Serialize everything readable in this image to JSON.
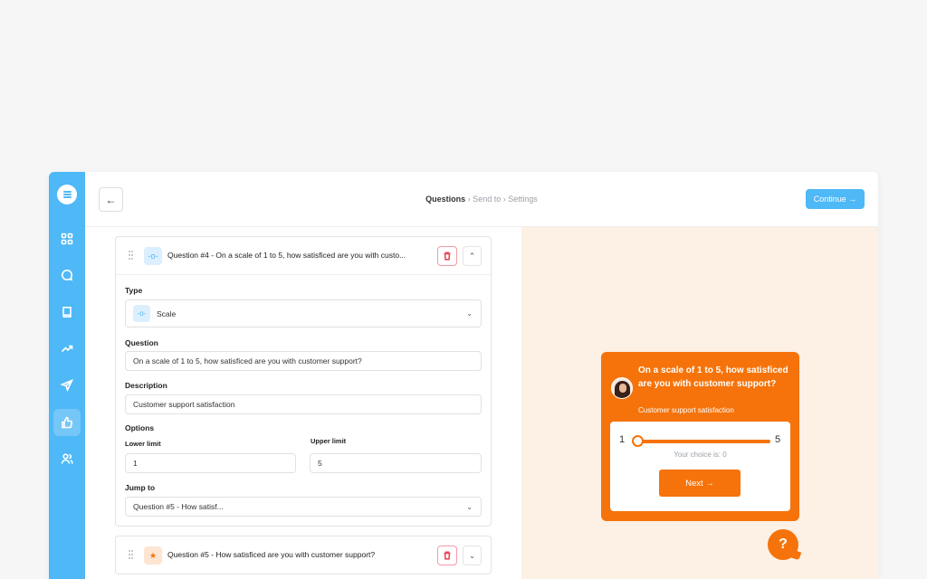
{
  "header": {
    "back_icon": "arrow-left-icon",
    "breadcrumb": [
      {
        "label": "Questions",
        "sep": "›"
      },
      {
        "label": "Send to",
        "sep": "›"
      },
      {
        "label": "Settings",
        "sep": ""
      }
    ],
    "continue_label": "Continue",
    "continue_arrow": "→"
  },
  "sidebar": {
    "items": [
      {
        "icon": "grid-icon"
      },
      {
        "icon": "chat-bubble-icon"
      },
      {
        "icon": "book-icon"
      },
      {
        "icon": "trending-up-icon"
      },
      {
        "icon": "send-icon"
      },
      {
        "icon": "thumbs-up-icon",
        "active": true
      },
      {
        "icon": "users-icon"
      }
    ]
  },
  "question4": {
    "icon_glyph": "-o-",
    "title": "Question #4 - On a scale of 1 to 5, how satisficed are you with custo...",
    "chevron": "⌃",
    "type_label": "Type",
    "type_value": "Scale",
    "type_icon_glyph": "-o-",
    "question_label": "Question",
    "question_value": "On a scale of 1 to 5, how satisficed are you with customer support?",
    "description_label": "Description",
    "description_value": "Customer support satisfaction",
    "options_label": "Options",
    "lower_limit_label": "Lower limit",
    "lower_limit_value": "1",
    "upper_limit_label": "Upper limit",
    "upper_limit_value": "5",
    "jump_label": "Jump to",
    "jump_value": "Question #5 - How satisf...",
    "dropdown_caret": "⌄"
  },
  "question5": {
    "icon_glyph": "★",
    "title": "Question #5 - How satisficed are you with customer support?",
    "chevron": "⌄"
  },
  "preview": {
    "title": "On a scale of 1 to 5, how satisficed are you with customer support?",
    "description": "Customer support satisfaction",
    "min": "1",
    "max": "5",
    "slider_value": 0,
    "choice_text": "Your choice is: 0",
    "next_label": "Next",
    "next_arrow": "→",
    "help_glyph": "?"
  },
  "colors": {
    "sidebar": "#4fb8f6",
    "accent_orange": "#f5730a",
    "preview_bg": "#fdf0e5",
    "delete_red": "#e34a5b"
  }
}
